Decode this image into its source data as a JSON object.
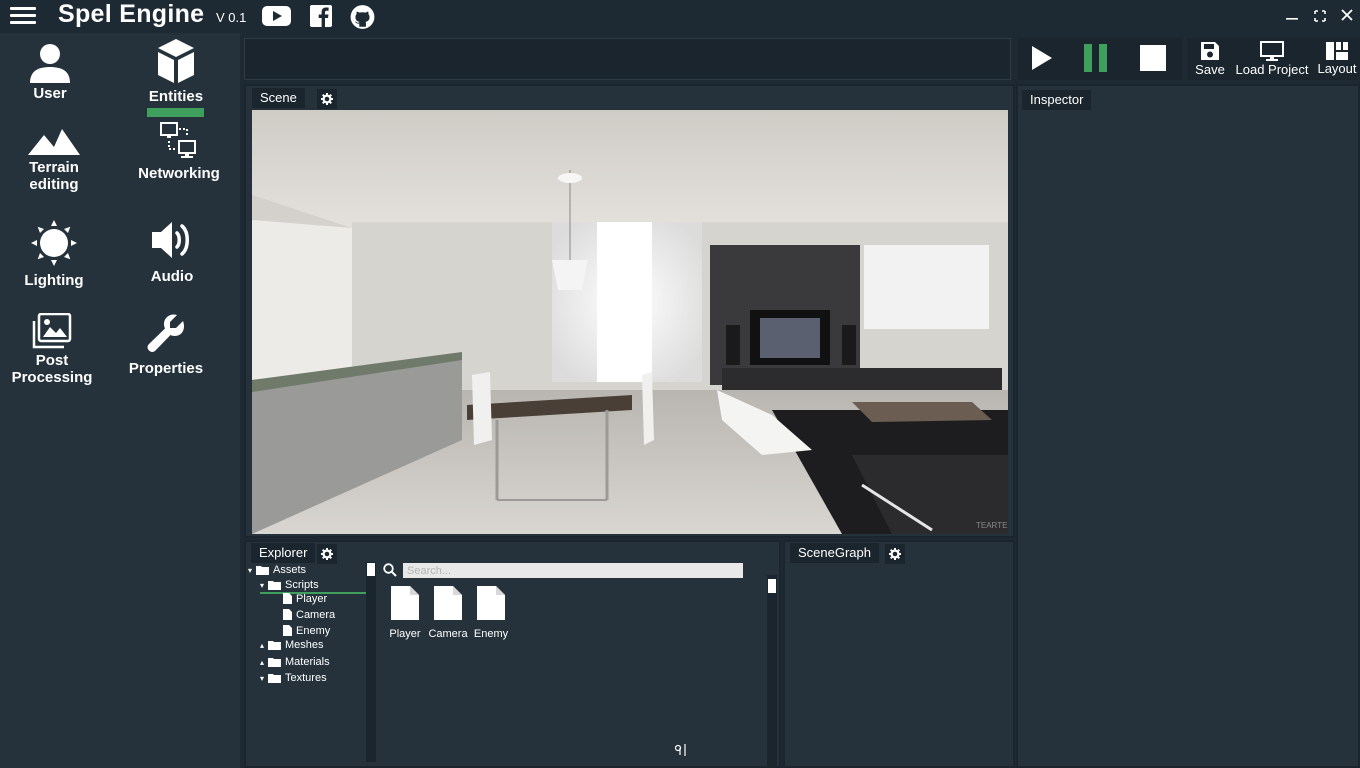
{
  "app": {
    "title": "Spel Engine",
    "version": "V 0.1"
  },
  "sidebar": {
    "items": [
      {
        "label": "User",
        "icon": "user-icon"
      },
      {
        "label": "Entities",
        "icon": "cube-icon"
      },
      {
        "label": "Terrain editing",
        "icon": "mountain-icon"
      },
      {
        "label": "Networking",
        "icon": "network-icon"
      },
      {
        "label": "Lighting",
        "icon": "sun-icon"
      },
      {
        "label": "Audio",
        "icon": "speaker-icon"
      },
      {
        "label": "Post Processing",
        "icon": "images-icon"
      },
      {
        "label": "Properties",
        "icon": "wrench-icon"
      }
    ],
    "active": "Entities"
  },
  "toolbar": {
    "save_label": "Save",
    "load_label": "Load Project",
    "layout_label": "Layout"
  },
  "panels": {
    "scene": "Scene",
    "inspector": "Inspector",
    "explorer": "Explorer",
    "scenegraph": "SceneGraph"
  },
  "viewport": {
    "watermark": "TEARTE"
  },
  "explorer": {
    "tree": [
      {
        "label": "Assets",
        "type": "folder"
      },
      {
        "label": "Scripts",
        "type": "folder"
      },
      {
        "label": "Player",
        "type": "file"
      },
      {
        "label": "Camera",
        "type": "file"
      },
      {
        "label": "Enemy",
        "type": "file"
      },
      {
        "label": "Meshes",
        "type": "folder"
      },
      {
        "label": "Materials",
        "type": "folder"
      },
      {
        "label": "Textures",
        "type": "folder"
      }
    ],
    "search_placeholder": "Search...",
    "files": [
      "Player",
      "Camera",
      "Enemy"
    ]
  },
  "colors": {
    "accent": "#3ea05c",
    "panel": "#25323c",
    "dark": "#1a252d"
  }
}
